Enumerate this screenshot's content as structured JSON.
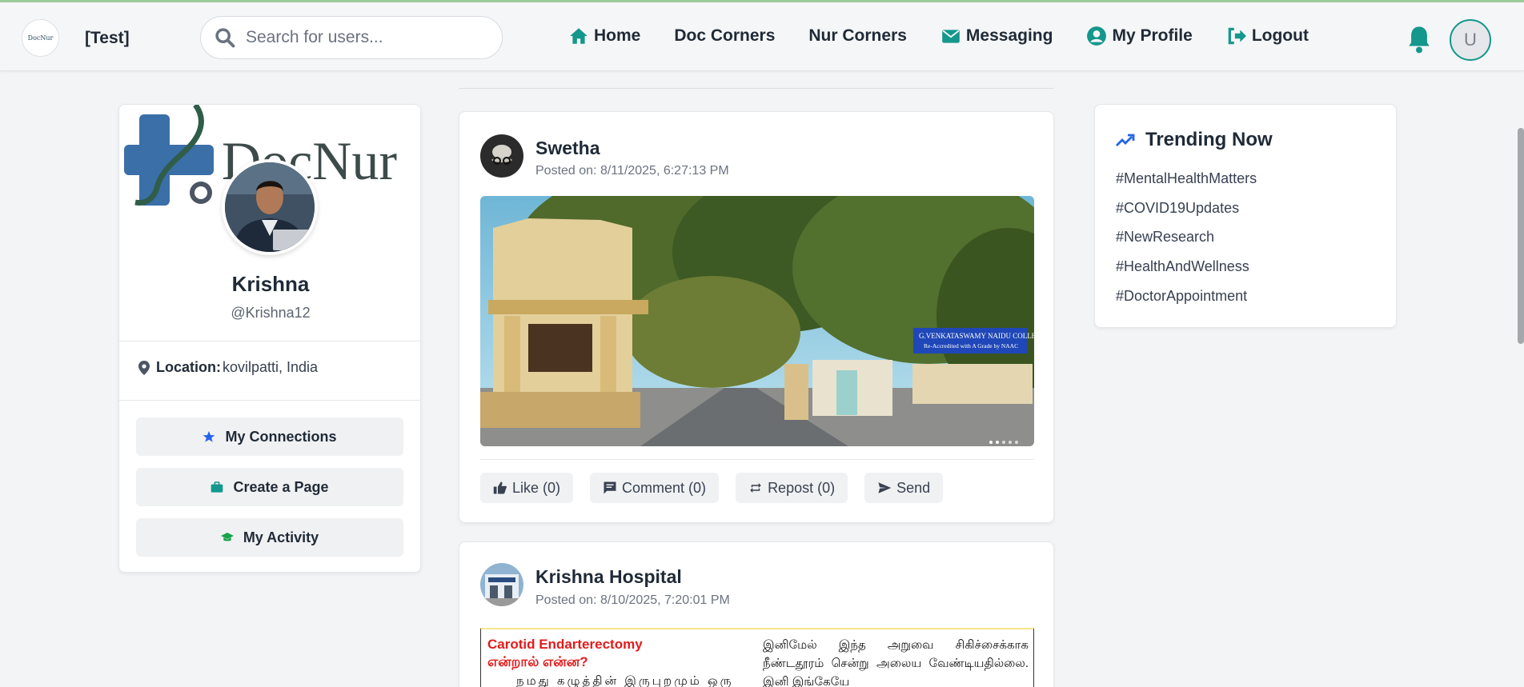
{
  "header": {
    "brand": "[Test]",
    "logo_text": "DocNur",
    "search_placeholder": "Search for users...",
    "avatar_initial": "U"
  },
  "nav": {
    "items": [
      {
        "label": "Home",
        "icon": "home-icon"
      },
      {
        "label": "Doc Corners",
        "icon": ""
      },
      {
        "label": "Nur Corners",
        "icon": ""
      },
      {
        "label": "Messaging",
        "icon": "envelope-icon"
      },
      {
        "label": "My Profile",
        "icon": "user-circle-icon"
      },
      {
        "label": "Logout",
        "icon": "logout-icon"
      }
    ]
  },
  "profile": {
    "banner_text": "DocNur",
    "name": "Krishna",
    "handle": "@Krishna12",
    "location_label": "Location:",
    "location_value": "kovilpatti, India",
    "buttons": [
      {
        "label": "My Connections",
        "icon": "star-icon",
        "color": "#2563eb"
      },
      {
        "label": "Create a Page",
        "icon": "briefcase-icon",
        "color": "#14978c"
      },
      {
        "label": "My Activity",
        "icon": "graduation-cap-icon",
        "color": "#16a34a"
      }
    ]
  },
  "posts": [
    {
      "author": "Swetha",
      "time": "Posted on: 8/11/2025, 6:27:13 PM",
      "image_sign_line1": "G.VENKATASWAMY NAIDU COLLEGE",
      "image_sign_line2": "Re-Accredited with A Grade by NAAC",
      "actions": {
        "like": "Like (0)",
        "comment": "Comment (0)",
        "repost": "Repost (0)",
        "send": "Send"
      }
    },
    {
      "author": "Krishna Hospital",
      "time": "Posted on: 8/10/2025, 7:20:01 PM",
      "doc_title_line1": "Carotid Endarterectomy",
      "doc_title_line2": "என்றால் என்ன?",
      "doc_col1_text": "நமது கழுத்தின் இருபுறமும் ஒரு",
      "doc_col2_text": "இனிமேல் இந்த அறுவை சிகிச்சைக்காக நீண்டதூரம் சென்று அலைய வேண்டியதில்லை. இனி இங்கேயே"
    }
  ],
  "trending": {
    "title": "Trending Now",
    "tags": [
      "#MentalHealthMatters",
      "#COVID19Updates",
      "#NewResearch",
      "#HealthAndWellness",
      "#DoctorAppointment"
    ]
  },
  "colors": {
    "accent_teal": "#14978c",
    "text_dark": "#1f2a37",
    "trend_blue": "#2563eb"
  }
}
